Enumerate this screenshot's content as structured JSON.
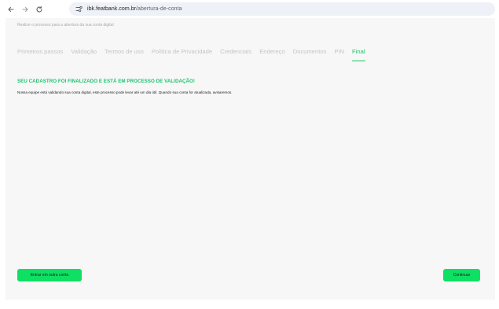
{
  "browser": {
    "back_icon": "arrow-left-icon",
    "forward_icon": "arrow-right-icon",
    "reload_icon": "reload-icon",
    "site_icon": "site-settings-icon",
    "url_host": "ibk.featbank.com.br",
    "url_path": "/abertura-de-conta"
  },
  "page": {
    "subtitle": "Realize o processo para a abertura da sua conta digital",
    "tabs": [
      {
        "label": "Primeiros passos"
      },
      {
        "label": "Validação"
      },
      {
        "label": "Termos de uso"
      },
      {
        "label": "Política de Privacidade"
      },
      {
        "label": "Credenciais"
      },
      {
        "label": "Endereço"
      },
      {
        "label": "Documentos"
      },
      {
        "label": "PIN"
      },
      {
        "label": "Final"
      }
    ],
    "active_tab": "Final",
    "headline": "SEU CADASTRO FOI FINALIZADO E ESTÁ EM PROCESSO DE VALIDAÇÃO!",
    "message": "Nossa equipe está validando sua conta digital, este processo pode levar até um dia útil. Quando sua conta for atualizada, avisaremos.",
    "other_account_label": "Entrar em outra conta",
    "continue_label": "Continuar"
  },
  "colors": {
    "accent": "#19c46a",
    "button": "#0fe064",
    "background": "#f7f7f7"
  }
}
